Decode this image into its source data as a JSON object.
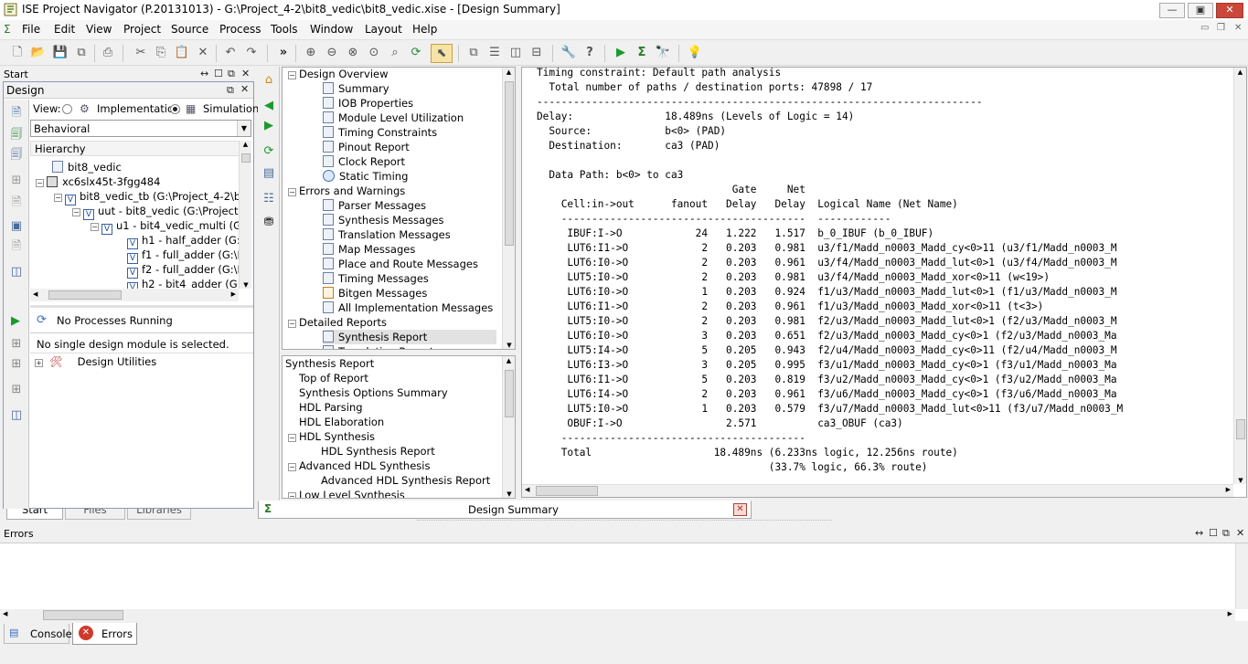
{
  "window": {
    "title": "ISE Project Navigator (P.20131013) - G:\\Project_4-2\\bit8_vedic\\bit8_vedic.xise - [Design Summary]"
  },
  "menu": [
    "File",
    "Edit",
    "View",
    "Project",
    "Source",
    "Process",
    "Tools",
    "Window",
    "Layout",
    "Help"
  ],
  "start_panel": {
    "title": "Start"
  },
  "design_panel": {
    "title": "Design",
    "view_label": "View:",
    "implementation": "Implementation",
    "simulation": "Simulation",
    "view_select": "Behavioral",
    "hierarchy_header": "Hierarchy"
  },
  "hierarchy": [
    "bit8_vedic",
    "xc6slx45t-3fgg484",
    "bit8_vedic_tb (G:\\Project_4-2\\b",
    "uut - bit8_vedic (G:\\Project",
    "u1 - bit4_vedic_multi (G",
    "h1 - half_adder (G:\\",
    "f1 - full_adder (G:\\P",
    "f2 - full_adder (G:\\P",
    "h2 - bit4_adder (G:\\"
  ],
  "processes": {
    "status": "No Processes Running",
    "message": "No single design module is selected.",
    "item": "Design Utilities"
  },
  "left_tabs": [
    "Start",
    "Files",
    "Libraries"
  ],
  "overview_tree": {
    "sections": [
      {
        "label": "Design Overview",
        "items": [
          "Summary",
          "IOB Properties",
          "Module Level Utilization",
          "Timing Constraints",
          "Pinout Report",
          "Clock Report",
          "Static Timing"
        ]
      },
      {
        "label": "Errors and Warnings",
        "items": [
          "Parser Messages",
          "Synthesis Messages",
          "Translation Messages",
          "Map Messages",
          "Place and Route Messages",
          "Timing Messages",
          "Bitgen Messages",
          "All Implementation Messages"
        ]
      },
      {
        "label": "Detailed Reports",
        "items": [
          "Synthesis Report",
          "Translation Report"
        ]
      }
    ]
  },
  "synthesis_tree": {
    "title": "Synthesis Report",
    "items": [
      {
        "label": "Top of Report",
        "level": 1
      },
      {
        "label": "Synthesis Options Summary",
        "level": 1
      },
      {
        "label": "HDL Parsing",
        "level": 1
      },
      {
        "label": "HDL Elaboration",
        "level": 1
      },
      {
        "label": "HDL Synthesis",
        "level": 1,
        "expand": true
      },
      {
        "label": "HDL Synthesis Report",
        "level": 2
      },
      {
        "label": "Advanced HDL Synthesis",
        "level": 1,
        "expand": true
      },
      {
        "label": "Advanced HDL Synthesis Report",
        "level": 2
      },
      {
        "label": "Low Level Synthesis",
        "level": 1,
        "expand": true
      }
    ]
  },
  "report": {
    "lines": [
      "Timing constraint: Default path analysis",
      "  Total number of paths / destination ports: 47898 / 17",
      "-------------------------------------------------------------------------",
      "Delay:               18.489ns (Levels of Logic = 14)",
      "  Source:            b<0> (PAD)",
      "  Destination:       ca3 (PAD)",
      "",
      "  Data Path: b<0> to ca3",
      "                                Gate     Net",
      "    Cell:in->out      fanout   Delay   Delay  Logical Name (Net Name)",
      "    ----------------------------------------  ------------",
      "     IBUF:I->O            24   1.222   1.517  b_0_IBUF (b_0_IBUF)",
      "     LUT6:I1->O            2   0.203   0.981  u3/f1/Madd_n0003_Madd_cy<0>11 (u3/f1/Madd_n0003_M",
      "     LUT6:I0->O            2   0.203   0.961  u3/f4/Madd_n0003_Madd_lut<0>1 (u3/f4/Madd_n0003_M",
      "     LUT5:I0->O            2   0.203   0.981  u3/f4/Madd_n0003_Madd_xor<0>11 (w<19>)",
      "     LUT6:I0->O            1   0.203   0.924  f1/u3/Madd_n0003_Madd_lut<0>1 (f1/u3/Madd_n0003_M",
      "     LUT6:I1->O            2   0.203   0.961  f1/u3/Madd_n0003_Madd_xor<0>11 (t<3>)",
      "     LUT5:I0->O            2   0.203   0.981  f2/u3/Madd_n0003_Madd_lut<0>1 (f2/u3/Madd_n0003_M",
      "     LUT6:I0->O            3   0.203   0.651  f2/u3/Madd_n0003_Madd_cy<0>1 (f2/u3/Madd_n0003_Ma",
      "     LUT5:I4->O            5   0.205   0.943  f2/u4/Madd_n0003_Madd_cy<0>11 (f2/u4/Madd_n0003_M",
      "     LUT6:I3->O            3   0.205   0.995  f3/u1/Madd_n0003_Madd_cy<0>1 (f3/u1/Madd_n0003_Ma",
      "     LUT6:I1->O            5   0.203   0.819  f3/u2/Madd_n0003_Madd_cy<0>1 (f3/u2/Madd_n0003_Ma",
      "     LUT6:I4->O            2   0.203   0.961  f3/u6/Madd_n0003_Madd_cy<0>1 (f3/u6/Madd_n0003_Ma",
      "     LUT5:I0->O            1   0.203   0.579  f3/u7/Madd_n0003_Madd_lut<0>11 (f3/u7/Madd_n0003_M",
      "     OBUF:I->O                 2.571          ca3_OBUF (ca3)",
      "    ----------------------------------------",
      "    Total                    18.489ns (6.233ns logic, 12.256ns route)",
      "                                      (33.7% logic, 66.3% route)"
    ]
  },
  "doc_tab": {
    "label": "Design Summary"
  },
  "errors_panel": {
    "title": "Errors"
  },
  "bottom_tabs": [
    "Console",
    "Errors"
  ]
}
